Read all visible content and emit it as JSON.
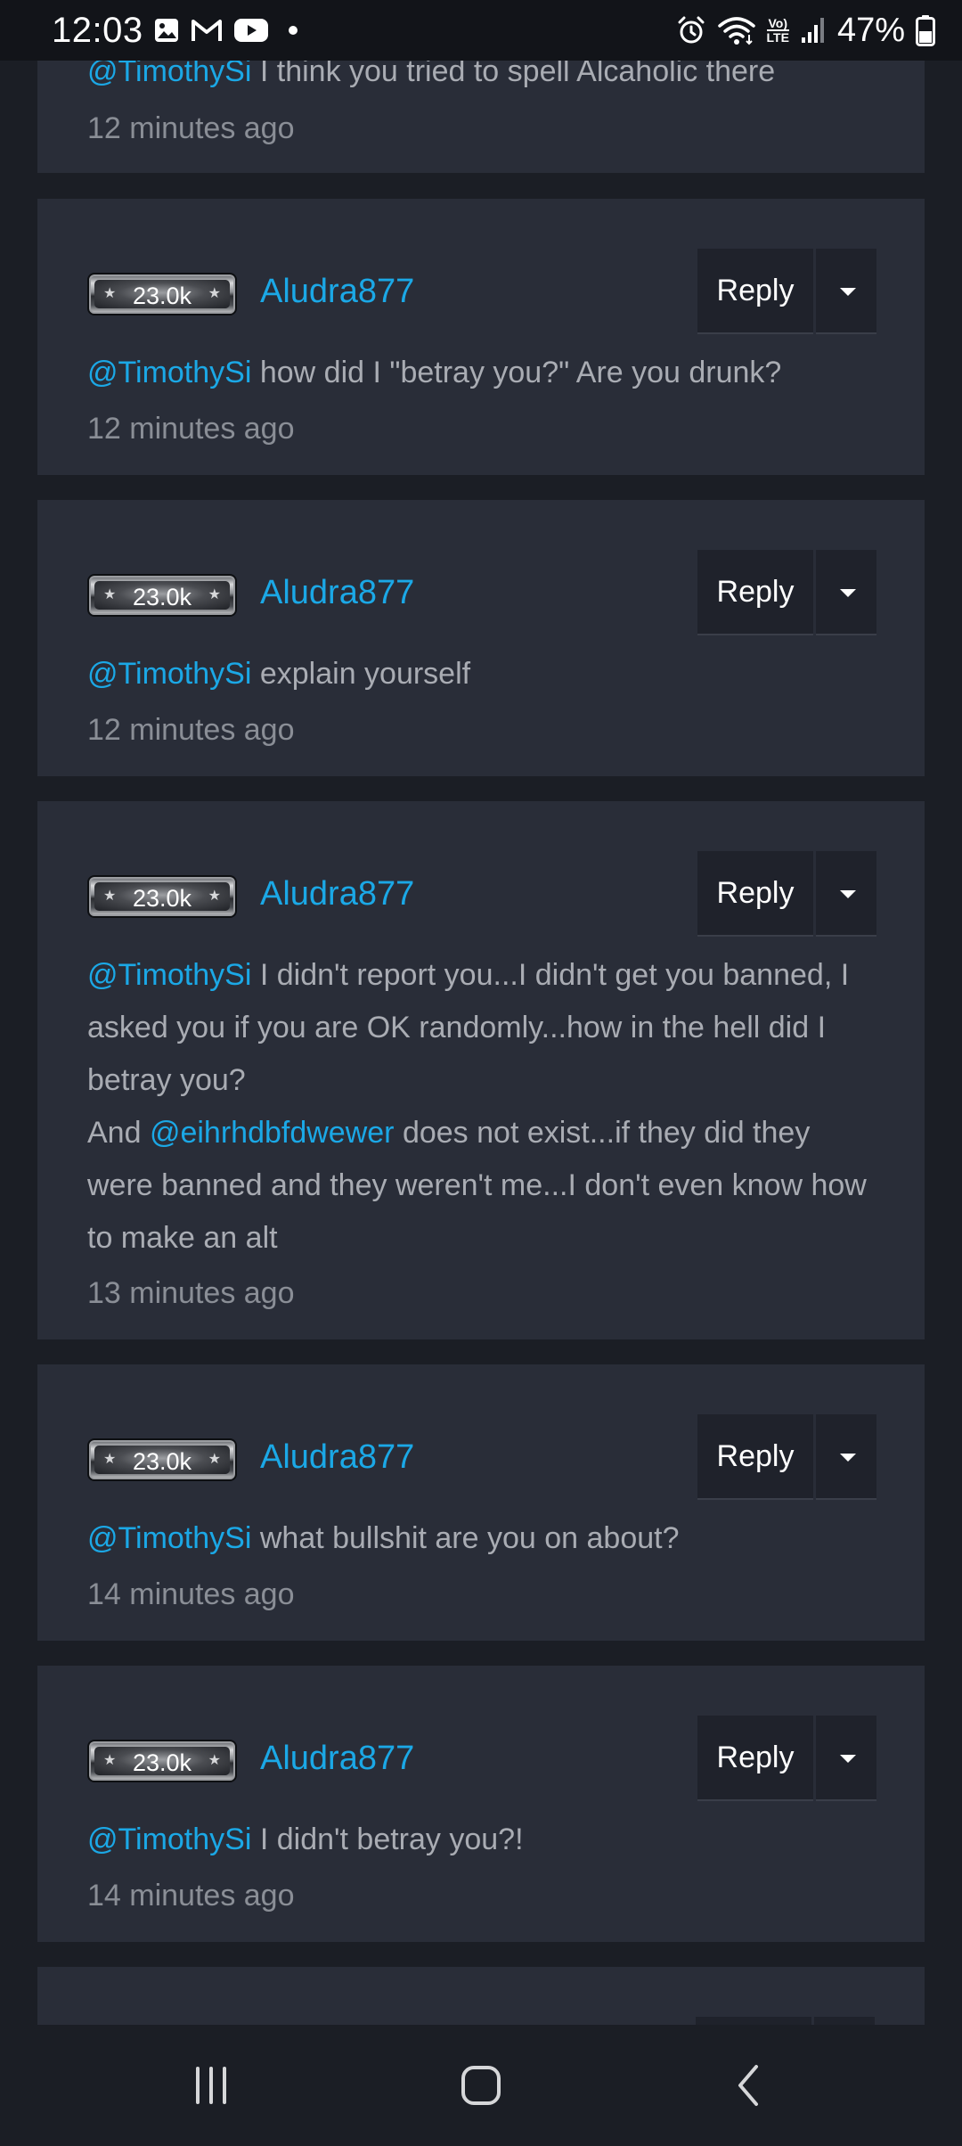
{
  "status_bar": {
    "time": "12:03",
    "battery": "47%",
    "left_icons": [
      "gallery-icon",
      "gmail-icon",
      "youtube-icon",
      "notification-dot-icon"
    ],
    "right_icons": [
      "alarm-icon",
      "wifi-icon",
      "volte-icon",
      "signal-icon",
      "battery-icon"
    ],
    "volte_line1": "Vo)",
    "volte_line2": "LTE"
  },
  "comments": [
    {
      "mention": "@TimothySi",
      "text": " I think you tried to spell Alcaholic there",
      "time": "12 minutes ago"
    },
    {
      "badge": "23.0k",
      "username": "Aludra877",
      "reply_label": "Reply",
      "mention": "@TimothySi",
      "text": " how did I \"betray you?\" Are you drunk?",
      "time": "12 minutes ago"
    },
    {
      "badge": "23.0k",
      "username": "Aludra877",
      "reply_label": "Reply",
      "mention": "@TimothySi",
      "text": " explain yourself",
      "time": "12 minutes ago"
    },
    {
      "badge": "23.0k",
      "username": "Aludra877",
      "reply_label": "Reply",
      "mention": "@TimothySi",
      "text": " I didn't report you...I didn't get you banned, I asked you if you are OK randomly...how in the hell did I betray you?",
      "line2_prefix": "And ",
      "mention2": "@eihrhdbfdwewer",
      "text2": " does not exist...if they did they were banned and they weren't me...I don't even know how to make an alt",
      "time": "13 minutes ago"
    },
    {
      "badge": "23.0k",
      "username": "Aludra877",
      "reply_label": "Reply",
      "mention": "@TimothySi",
      "text": " what bullshit are you on about?",
      "time": "14 minutes ago"
    },
    {
      "badge": "23.0k",
      "username": "Aludra877",
      "reply_label": "Reply",
      "mention": "@TimothySi",
      "text": " I didn't betray you?!",
      "time": "14 minutes ago"
    }
  ],
  "nav_bar": {
    "buttons": [
      "recent-apps-icon",
      "home-icon",
      "back-icon"
    ]
  },
  "colors": {
    "background": "#1b1e25",
    "card": "#292d38",
    "accent": "#1ba8e6",
    "text": "#a9acb3",
    "muted": "#8a8e96"
  }
}
